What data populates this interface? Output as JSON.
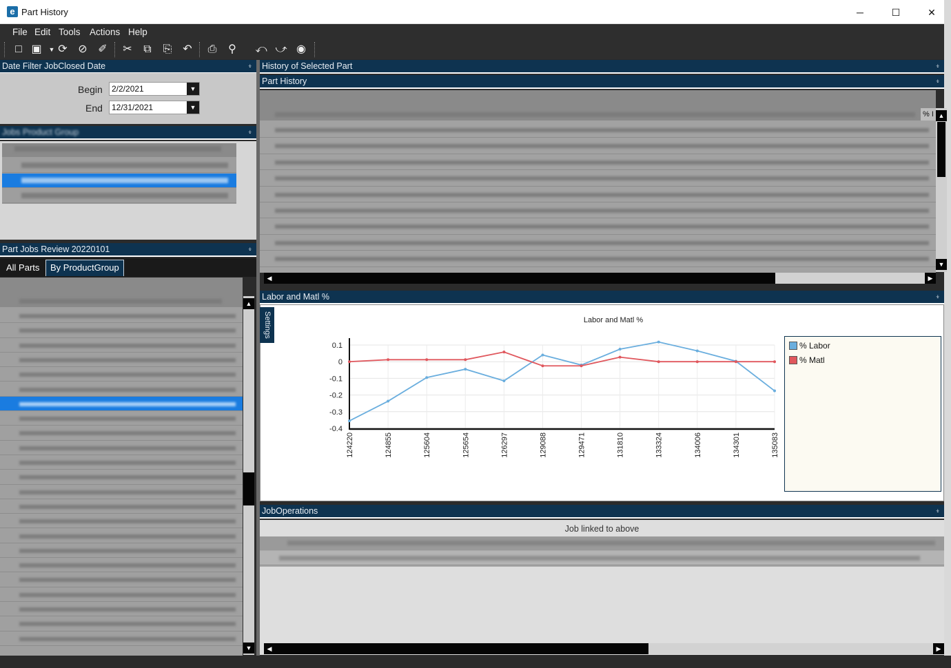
{
  "window": {
    "title": "Part History",
    "logo_letter": "e",
    "minimize": "─",
    "maximize": "☐",
    "close": "✕"
  },
  "menu": [
    "File",
    "Edit",
    "Tools",
    "Actions",
    "Help"
  ],
  "toolbar": {
    "icons": [
      "new-icon",
      "save-icon",
      "refresh-icon",
      "cancel-icon",
      "clear-icon",
      "cut-icon",
      "copy-icon",
      "paste-icon",
      "undo-icon",
      "print-icon",
      "print-preview-icon",
      "back-icon",
      "forward-icon",
      "stop-icon"
    ]
  },
  "date_filter": {
    "title": "Date Filter JobClosed Date",
    "begin_label": "Begin",
    "begin_value": "2/2/2021",
    "end_label": "End",
    "end_value": "12/31/2021"
  },
  "jobs_product_group": {
    "title": "Jobs Product Group"
  },
  "part_jobs_review": {
    "title": "Part Jobs Review 20220101",
    "tabs": [
      "All Parts",
      "By ProductGroup"
    ],
    "active_tab": 1
  },
  "history_of_selected_part": {
    "title": "History of Selected Part"
  },
  "part_history": {
    "title": "Part History",
    "last_col_header": "% I"
  },
  "labor_matl": {
    "title": "Labor and Matl %",
    "settings_label": "Settings"
  },
  "chart_data": {
    "type": "line",
    "title": "Labor and Matl %",
    "categories": [
      "124220",
      "124855",
      "125604",
      "125654",
      "126297",
      "129088",
      "129471",
      "131810",
      "133324",
      "134006",
      "134301",
      "135083"
    ],
    "series": [
      {
        "name": "% Labor",
        "color": "#6aaede",
        "values": [
          -0.355,
          -0.237,
          -0.095,
          -0.045,
          -0.115,
          0.04,
          -0.02,
          0.075,
          0.118,
          0.065,
          0.003,
          -0.175
        ]
      },
      {
        "name": "% Matl",
        "color": "#e0575d",
        "values": [
          0.0,
          0.012,
          0.012,
          0.012,
          0.058,
          -0.025,
          -0.025,
          0.027,
          0.0,
          0.0,
          0.0,
          0.0
        ]
      }
    ],
    "yticks": [
      "0.1",
      "0",
      "-0.1",
      "-0.2",
      "-0.3",
      "-0.4"
    ],
    "ylim": [
      -0.4,
      0.1
    ],
    "grid": true,
    "legend": "right"
  },
  "job_operations": {
    "title": "JobOperations",
    "subtitle": "Job linked to above"
  }
}
